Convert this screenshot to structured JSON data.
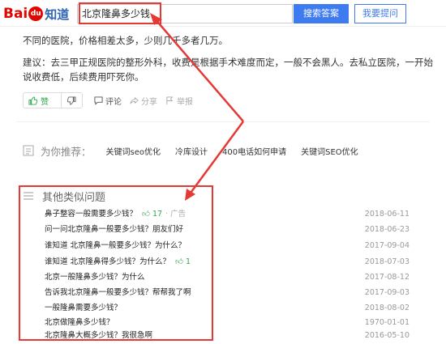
{
  "header": {
    "logo_bai": "Bai",
    "logo_du": "du",
    "logo_zhidao": "知道",
    "search_value": "北京隆鼻多少钱",
    "search_button": "搜索答案",
    "ask_button": "我要提问"
  },
  "answer": {
    "line1": "不同的医院，价格相差太多，少则几千多者几万。",
    "line2": "建议：去三甲正规医院的整形外科，收费是根据手术难度而定，一般不会黑人。去私立医院，一开始",
    "line3": "说收费低，后续费用吓死你。",
    "actions": {
      "like_label": "赞",
      "comment_label": "评论",
      "share_label": "分享",
      "report_label": "举报"
    }
  },
  "recommend": {
    "title": "为你推荐：",
    "tags": [
      "关键词seo优化",
      "冷库设计",
      "400电话如何申请",
      "关键词SEO优化"
    ]
  },
  "similar": {
    "title": "其他类似问题",
    "rows": [
      {
        "q": "鼻子整容一般需要多少钱？",
        "likes": "17",
        "ad": "· 广告",
        "date": "2018-06-11"
      },
      {
        "q": "问一问北京隆鼻一般要多少钱？朋友们好",
        "date": "2018-06-23"
      },
      {
        "q": "谁知道 北京隆鼻一般要多少钱？为什么？",
        "date": "2017-09-04"
      },
      {
        "q": "谁知道 北京隆鼻得多少钱？为什么？",
        "likes": "1",
        "date": "2018-07-03"
      },
      {
        "q": "北京一般隆鼻多少钱？为什么",
        "date": "2017-08-12"
      },
      {
        "q": "告诉我北京隆鼻一般要多少钱？帮帮我了啊",
        "date": "2017-09-03"
      },
      {
        "q": "一般隆鼻需要多少钱？",
        "date": "2018-08-02"
      },
      {
        "q": "北京做隆鼻多少钱？",
        "date": "1970-01-01"
      },
      {
        "q": "北京隆鼻大概多少钱？我很急啊",
        "date": "2016-05-10"
      }
    ]
  },
  "colors": {
    "annotation_red": "#e53935",
    "brand_blue": "#3e7bf1",
    "like_green": "#2fa84f"
  }
}
